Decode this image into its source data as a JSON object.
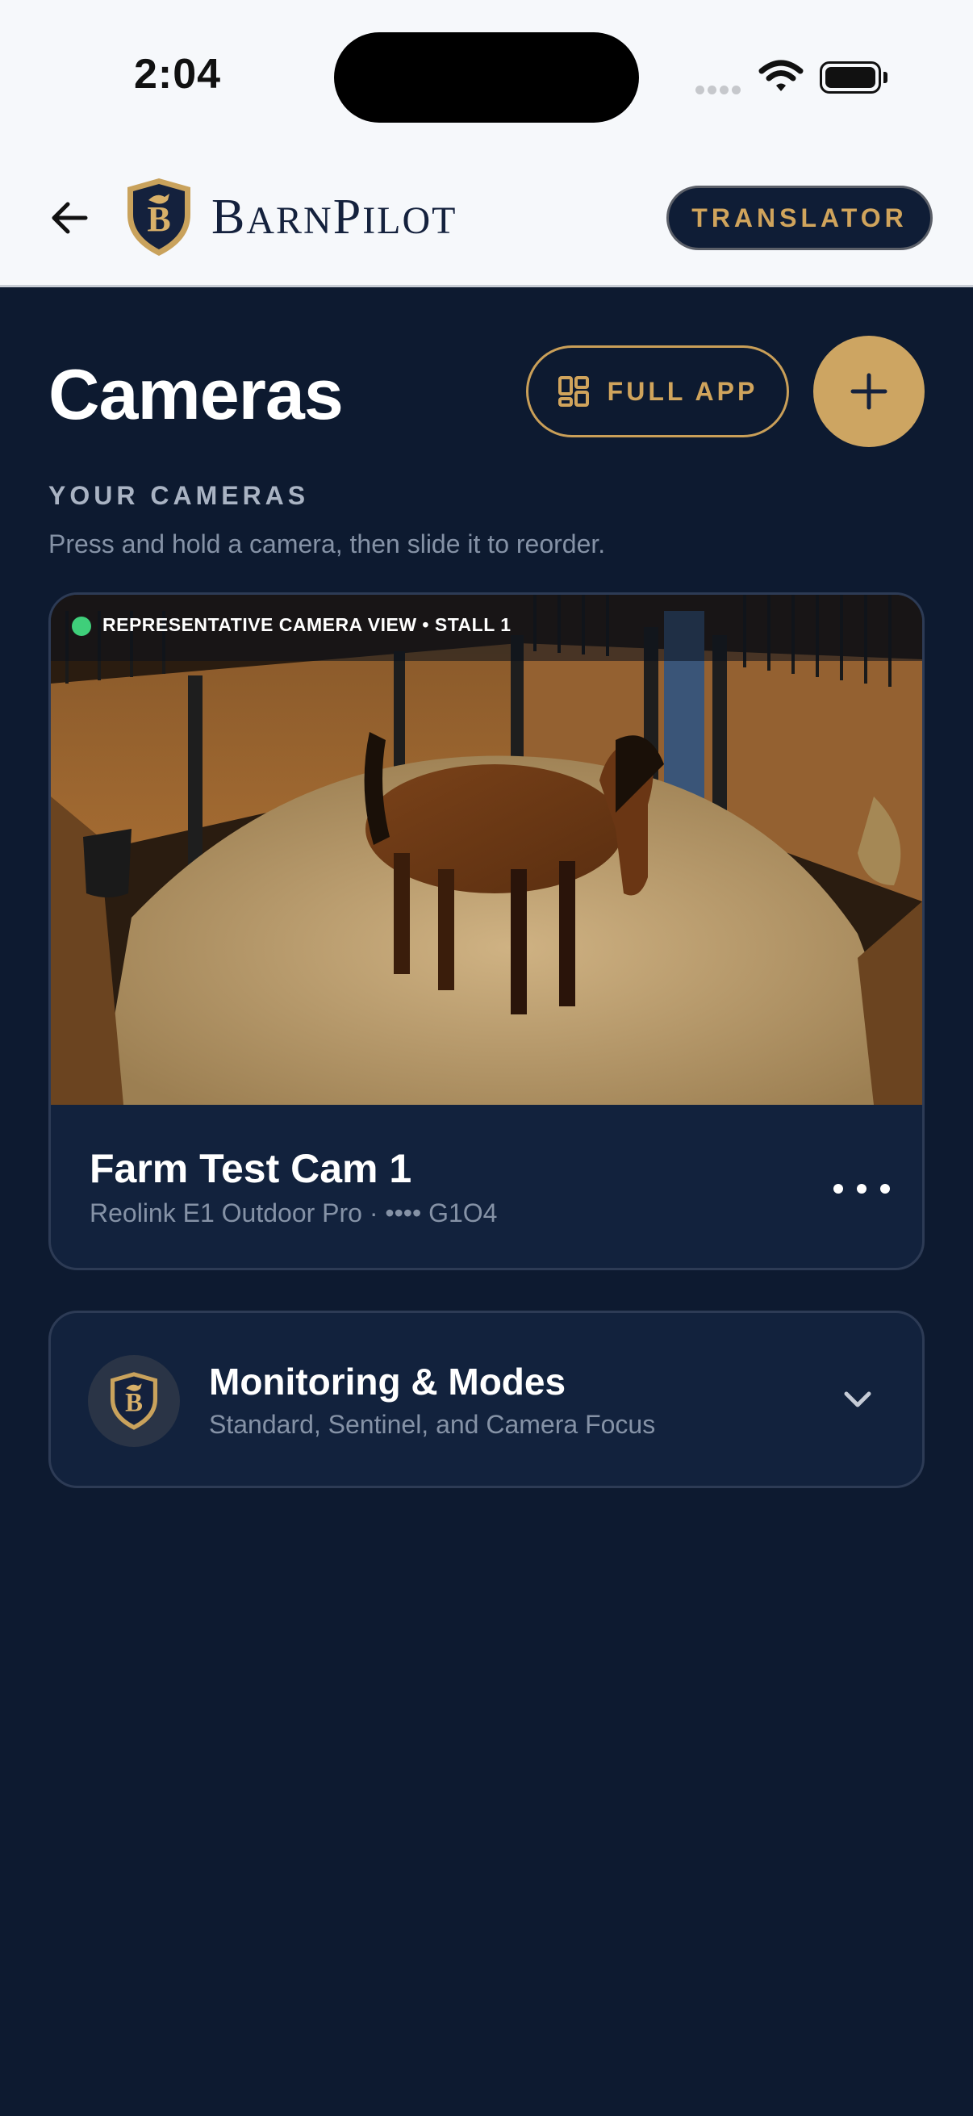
{
  "status_bar": {
    "time": "2:04"
  },
  "header": {
    "brand_first": "B",
    "brand_rest1": "ARN",
    "brand_p": "P",
    "brand_rest2": "ILOT",
    "translator_label": "TRANSLATOR"
  },
  "page": {
    "title": "Cameras",
    "full_app_label": "FULL APP",
    "section_label": "YOUR CAMERAS",
    "section_hint": "Press and hold a camera, then slide it to reorder."
  },
  "camera": {
    "caption": "REPRESENTATIVE CAMERA VIEW • STALL 1",
    "name": "Farm Test Cam 1",
    "subtitle": "Reolink E1 Outdoor Pro · •••• G1O4"
  },
  "monitoring": {
    "title": "Monitoring & Modes",
    "subtitle": "Standard, Sentinel, and Camera Focus"
  },
  "colors": {
    "background": "#0d1a30",
    "card": "#12223d",
    "gold": "#cda562",
    "live": "#3fcf7a"
  },
  "icons": [
    "back-arrow-icon",
    "shield-logo-icon",
    "grid-icon",
    "plus-icon",
    "more-icon",
    "chevron-down-icon",
    "wifi-icon",
    "battery-icon"
  ]
}
